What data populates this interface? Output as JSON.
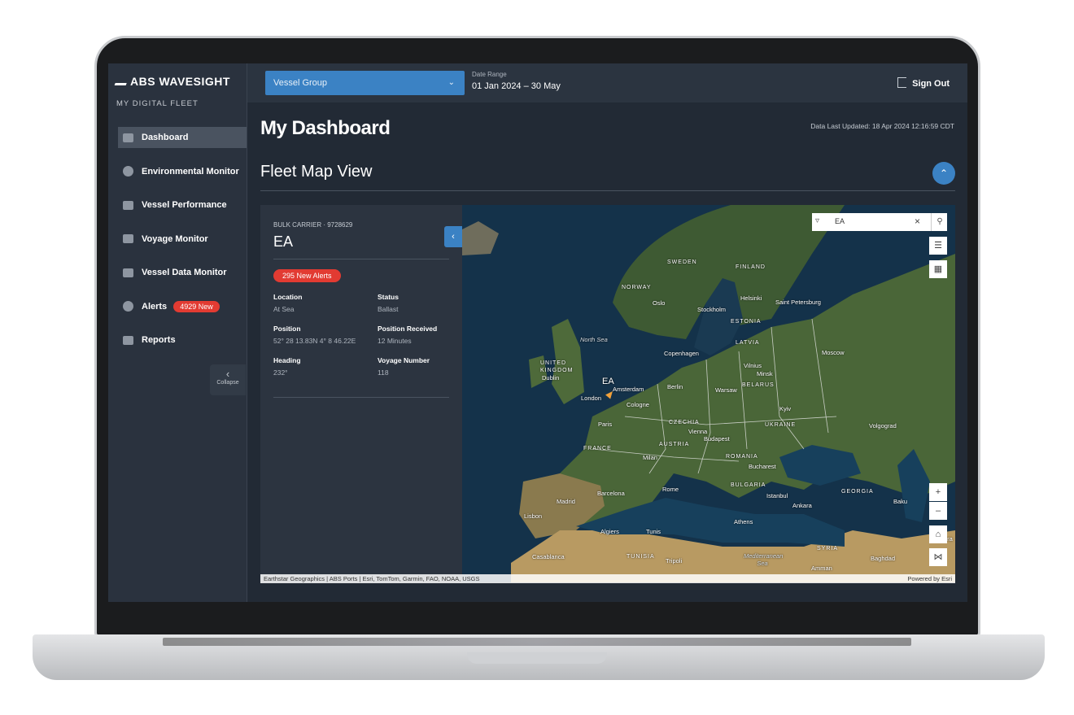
{
  "brand": {
    "logo": "ABS WAVESIGHT",
    "sub": "MY DIGITAL FLEET"
  },
  "sidebar": {
    "items": [
      {
        "label": "Dashboard",
        "icon": "dashboard-icon"
      },
      {
        "label": "Environmental Monitor",
        "icon": "cloud-icon"
      },
      {
        "label": "Vessel Performance",
        "icon": "performance-icon"
      },
      {
        "label": "Voyage Monitor",
        "icon": "voyage-icon"
      },
      {
        "label": "Vessel Data Monitor",
        "icon": "grid-icon"
      },
      {
        "label": "Alerts",
        "icon": "alert-icon",
        "badge": "4929 New"
      },
      {
        "label": "Reports",
        "icon": "folder-icon"
      }
    ],
    "collapse_label": "Collapse"
  },
  "header": {
    "vessel_group": "Vessel Group",
    "date_range_label": "Date Range",
    "date_range": "01 Jan 2024 – 30 May",
    "sign_out": "Sign Out"
  },
  "main": {
    "title": "My Dashboard",
    "updated": "Data Last Updated: 18 Apr 2024 12:16:59 CDT",
    "section": "Fleet Map View"
  },
  "vessel": {
    "type": "BULK CARRIER · 9728629",
    "name": "EA",
    "alerts": "295 New Alerts",
    "fields": [
      {
        "label": "Location",
        "value": "At Sea"
      },
      {
        "label": "Status",
        "value": "Ballast"
      },
      {
        "label": "Position",
        "value": "52° 28 13.83N 4° 8 46.22E"
      },
      {
        "label": "Position Received",
        "value": "12 Minutes"
      },
      {
        "label": "Heading",
        "value": "232°"
      },
      {
        "label": "Voyage Number",
        "value": "118"
      }
    ]
  },
  "map": {
    "search_value": "EA",
    "vessel_label": "EA",
    "attribution": "Earthstar Geographics | ABS Ports | Esri, TomTom, Garmin, FAO, NOAA, USGS",
    "powered": "Powered by Esri",
    "labels": {
      "sweden": "SWEDEN",
      "finland": "FINLAND",
      "norway": "NORWAY",
      "oslo": "Oslo",
      "stockholm": "Stockholm",
      "helsinki": "Helsinki",
      "stpetersburg": "Saint Petersburg",
      "estonia": "ESTONIA",
      "latvia": "LATVIA",
      "northsea": "North Sea",
      "copenhagen": "Copenhagen",
      "moscow": "Moscow",
      "uk": "UNITED KINGDOM",
      "dublin": "Dublin",
      "vilnius": "Vilnius",
      "minsk": "Minsk",
      "belarus": "BELARUS",
      "amsterdam": "Amsterdam",
      "berlin": "Berlin",
      "warsaw": "Warsaw",
      "london": "London",
      "cologne": "Cologne",
      "kyiv": "Kyiv",
      "paris": "Paris",
      "czechia": "CZECHIA",
      "ukraine": "UKRAINE",
      "volgograd": "Volgograd",
      "vienna": "Vienna",
      "budapest": "Budapest",
      "france": "FRANCE",
      "austria": "AUSTRIA",
      "milan": "Milan",
      "romania": "ROMANIA",
      "bucharest": "Bucharest",
      "bulgaria": "BULGARIA",
      "barcelona": "Barcelona",
      "rome": "Rome",
      "georgia": "GEORGIA",
      "madrid": "Madrid",
      "istanbul": "Istanbul",
      "baku": "Baku",
      "lisbon": "Lisbon",
      "ankara": "Ankara",
      "athens": "Athens",
      "algiers": "Algiers",
      "tunis": "Tunis",
      "tehran": "Tehra",
      "casablanca": "Casablanca",
      "tunisia": "TUNISIA",
      "tripoli": "Tripoli",
      "medsea": "Mediterranean Sea",
      "syria": "SYRIA",
      "baghdad": "Baghdad",
      "amman": "Amman"
    }
  },
  "colors": {
    "accent": "#3b82c4",
    "alert": "#e23b32",
    "bg": "#222a35"
  }
}
